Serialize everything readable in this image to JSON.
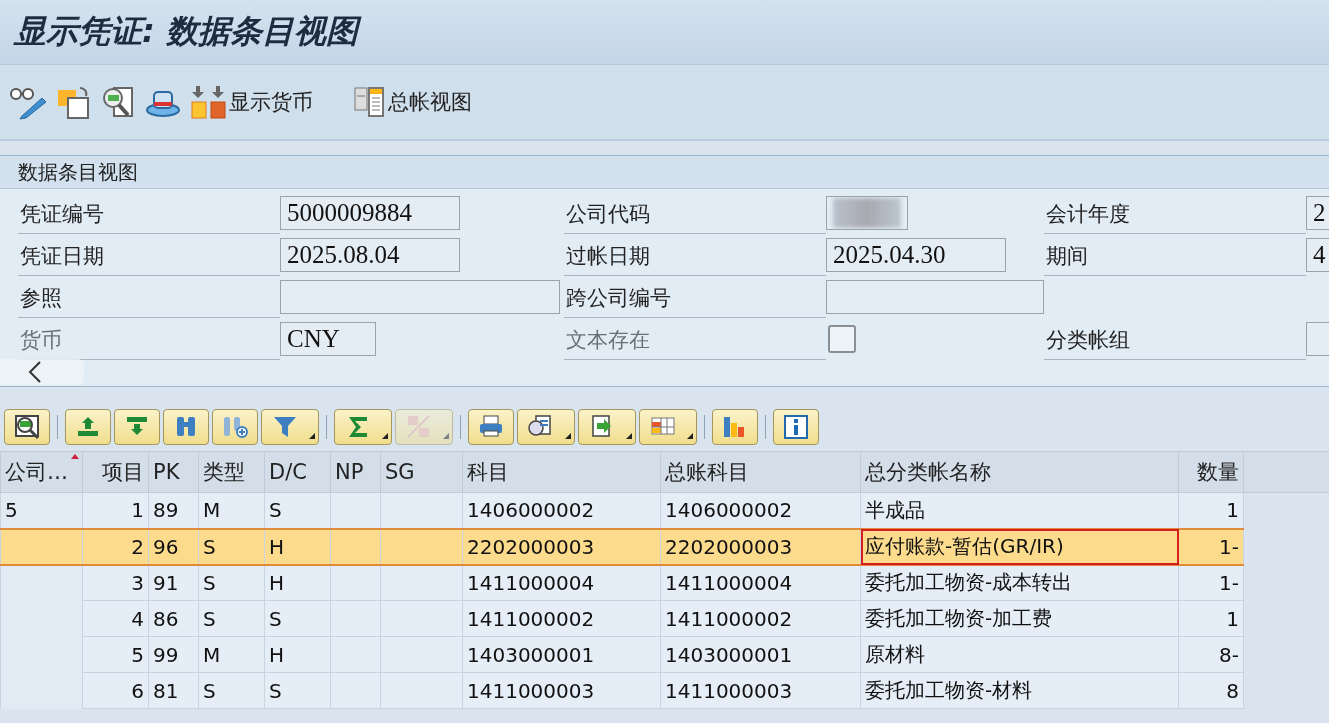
{
  "window": {
    "title": "显示凭证: 数据条目视图"
  },
  "toolbar": [
    {
      "kind": "glasses"
    },
    {
      "kind": "copy"
    },
    {
      "kind": "inspect"
    },
    {
      "kind": "hat"
    },
    {
      "kind": "currency",
      "label": "显示货币"
    },
    {
      "kind": "ledger",
      "label": "总帐视图"
    }
  ],
  "panel": {
    "title": "数据条目视图",
    "rows": [
      [
        {
          "label": "凭证编号",
          "value": "5000009884",
          "disabled": false
        },
        {
          "label": "公司代码",
          "redacted": true,
          "disabled": false
        },
        {
          "label": "会计年度",
          "value": "2",
          "disabled": false
        }
      ],
      [
        {
          "label": "凭证日期",
          "value": "2025.08.04",
          "disabled": false
        },
        {
          "label": "过帐日期",
          "value": "2025.04.30",
          "disabled": false
        },
        {
          "label": "期间",
          "value": "4",
          "disabled": false
        }
      ],
      [
        {
          "label": "参照",
          "disabled": false
        },
        {
          "label": "跨公司编号",
          "disabled": false
        }
      ],
      [
        {
          "label": "货币",
          "value": "CNY",
          "disabled": true
        },
        {
          "label": "文本存在",
          "kind": "checkbox",
          "checked": false,
          "disabled": true
        },
        {
          "label": "分类帐组",
          "disabled": false
        }
      ]
    ]
  },
  "table_toolbar": [
    [
      {
        "kind": "detail",
        "menu": false,
        "disabled": false
      }
    ],
    [
      {
        "kind": "sort-asc",
        "menu": false,
        "disabled": false
      },
      {
        "kind": "sort-desc",
        "menu": false,
        "disabled": false
      },
      {
        "kind": "find",
        "menu": false,
        "disabled": false
      },
      {
        "kind": "find-next",
        "menu": false,
        "disabled": false
      },
      {
        "kind": "filter",
        "menu": true,
        "disabled": false
      }
    ],
    [
      {
        "kind": "sum",
        "menu": true,
        "disabled": false
      },
      {
        "kind": "subtotal",
        "menu": true,
        "disabled": true
      }
    ],
    [
      {
        "kind": "print",
        "menu": false,
        "disabled": false
      },
      {
        "kind": "views",
        "menu": true,
        "disabled": false
      },
      {
        "kind": "export",
        "menu": true,
        "disabled": false
      },
      {
        "kind": "layout",
        "menu": true,
        "disabled": false
      }
    ],
    [
      {
        "kind": "chart",
        "menu": false,
        "disabled": false
      }
    ],
    [
      {
        "kind": "info",
        "menu": false,
        "disabled": false
      }
    ]
  ],
  "table": {
    "columns": [
      {
        "label": "公司…",
        "sorted": true
      },
      {
        "label": "项目",
        "sorted": false
      },
      {
        "label": "PK",
        "sorted": false
      },
      {
        "label": "类型",
        "sorted": false
      },
      {
        "label": "D/C",
        "sorted": false
      },
      {
        "label": "NP",
        "sorted": false
      },
      {
        "label": "SG",
        "sorted": false
      },
      {
        "label": "科目",
        "sorted": false
      },
      {
        "label": "总账科目",
        "sorted": false
      },
      {
        "label": "总分类帐名称",
        "sorted": false
      },
      {
        "label": "数量",
        "sorted": false
      }
    ],
    "rows": [
      {
        "selected": false,
        "name_focused": false,
        "cells": [
          "5",
          "1",
          "89",
          "M",
          "S",
          null,
          null,
          "1406000002",
          "1406000002",
          "半成品",
          "1"
        ]
      },
      {
        "selected": true,
        "name_focused": true,
        "cells": [
          null,
          "2",
          "96",
          "S",
          "H",
          null,
          null,
          "2202000003",
          "2202000003",
          "应付账款-暂估(GR/IR)",
          "1-"
        ]
      },
      {
        "selected": false,
        "name_focused": false,
        "cells": [
          null,
          "3",
          "91",
          "S",
          "H",
          null,
          null,
          "1411000004",
          "1411000004",
          "委托加工物资-成本转出",
          "1-"
        ]
      },
      {
        "selected": false,
        "name_focused": false,
        "cells": [
          null,
          "4",
          "86",
          "S",
          "S",
          null,
          null,
          "1411000002",
          "1411000002",
          "委托加工物资-加工费",
          "1"
        ]
      },
      {
        "selected": false,
        "name_focused": false,
        "cells": [
          null,
          "5",
          "99",
          "M",
          "H",
          null,
          null,
          "1403000001",
          "1403000001",
          "原材料",
          "8-"
        ]
      },
      {
        "selected": false,
        "name_focused": false,
        "cells": [
          null,
          "6",
          "81",
          "S",
          "S",
          null,
          null,
          "1411000003",
          "1411000003",
          "委托加工物资-材料",
          "8"
        ]
      }
    ]
  }
}
